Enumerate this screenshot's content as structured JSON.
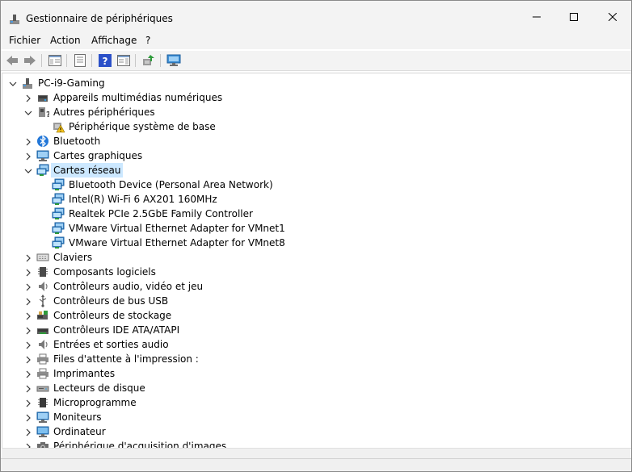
{
  "window": {
    "title": "Gestionnaire de périphériques",
    "controls": [
      "minimize",
      "maximize",
      "close"
    ]
  },
  "menu": [
    "Fichier",
    "Action",
    "Affichage",
    "?"
  ],
  "toolbar": {
    "icons": [
      "back-arrow-icon",
      "forward-arrow-icon",
      "console-tree-icon",
      "properties-icon",
      "help-icon",
      "action-pane-icon",
      "update-driver-icon",
      "scan-hardware-icon"
    ]
  },
  "tree": {
    "root": "PC-i9-Gaming",
    "items": [
      {
        "label": "Appareils multimédias numériques",
        "level": 1,
        "expanded": false,
        "icon": "multimedia-icon"
      },
      {
        "label": "Autres périphériques",
        "level": 1,
        "expanded": true,
        "icon": "other-devices-icon"
      },
      {
        "label": "Périphérique système de base",
        "level": 2,
        "expanded": null,
        "icon": "warning-device-icon"
      },
      {
        "label": "Bluetooth",
        "level": 1,
        "expanded": false,
        "icon": "bluetooth-icon"
      },
      {
        "label": "Cartes graphiques",
        "level": 1,
        "expanded": false,
        "icon": "display-adapter-icon"
      },
      {
        "label": "Cartes réseau",
        "level": 1,
        "expanded": true,
        "icon": "network-adapter-icon",
        "selected": true
      },
      {
        "label": "Bluetooth Device (Personal Area Network)",
        "level": 2,
        "expanded": null,
        "icon": "network-adapter-icon"
      },
      {
        "label": "Intel(R) Wi-Fi 6 AX201 160MHz",
        "level": 2,
        "expanded": null,
        "icon": "network-adapter-icon"
      },
      {
        "label": "Realtek PCIe 2.5GbE Family Controller",
        "level": 2,
        "expanded": null,
        "icon": "network-adapter-icon"
      },
      {
        "label": "VMware Virtual Ethernet Adapter for VMnet1",
        "level": 2,
        "expanded": null,
        "icon": "network-adapter-icon"
      },
      {
        "label": "VMware Virtual Ethernet Adapter for VMnet8",
        "level": 2,
        "expanded": null,
        "icon": "network-adapter-icon"
      },
      {
        "label": "Claviers",
        "level": 1,
        "expanded": false,
        "icon": "keyboard-icon"
      },
      {
        "label": "Composants logiciels",
        "level": 1,
        "expanded": false,
        "icon": "software-component-icon"
      },
      {
        "label": "Contrôleurs audio, vidéo et jeu",
        "level": 1,
        "expanded": false,
        "icon": "speaker-icon"
      },
      {
        "label": "Contrôleurs de bus USB",
        "level": 1,
        "expanded": false,
        "icon": "usb-icon"
      },
      {
        "label": "Contrôleurs de stockage",
        "level": 1,
        "expanded": false,
        "icon": "storage-controller-icon"
      },
      {
        "label": "Contrôleurs IDE ATA/ATAPI",
        "level": 1,
        "expanded": false,
        "icon": "ide-controller-icon"
      },
      {
        "label": "Entrées et sorties audio",
        "level": 1,
        "expanded": false,
        "icon": "speaker-icon"
      },
      {
        "label": "Files d'attente à l'impression :",
        "level": 1,
        "expanded": false,
        "icon": "printer-icon"
      },
      {
        "label": "Imprimantes",
        "level": 1,
        "expanded": false,
        "icon": "printer-icon"
      },
      {
        "label": "Lecteurs de disque",
        "level": 1,
        "expanded": false,
        "icon": "disk-drive-icon"
      },
      {
        "label": "Microprogramme",
        "level": 1,
        "expanded": false,
        "icon": "firmware-icon"
      },
      {
        "label": "Moniteurs",
        "level": 1,
        "expanded": false,
        "icon": "monitor-icon"
      },
      {
        "label": "Ordinateur",
        "level": 1,
        "expanded": false,
        "icon": "computer-icon"
      },
      {
        "label": "Périphérique d'acquisition d'images",
        "level": 1,
        "expanded": false,
        "icon": "camera-icon"
      }
    ]
  }
}
